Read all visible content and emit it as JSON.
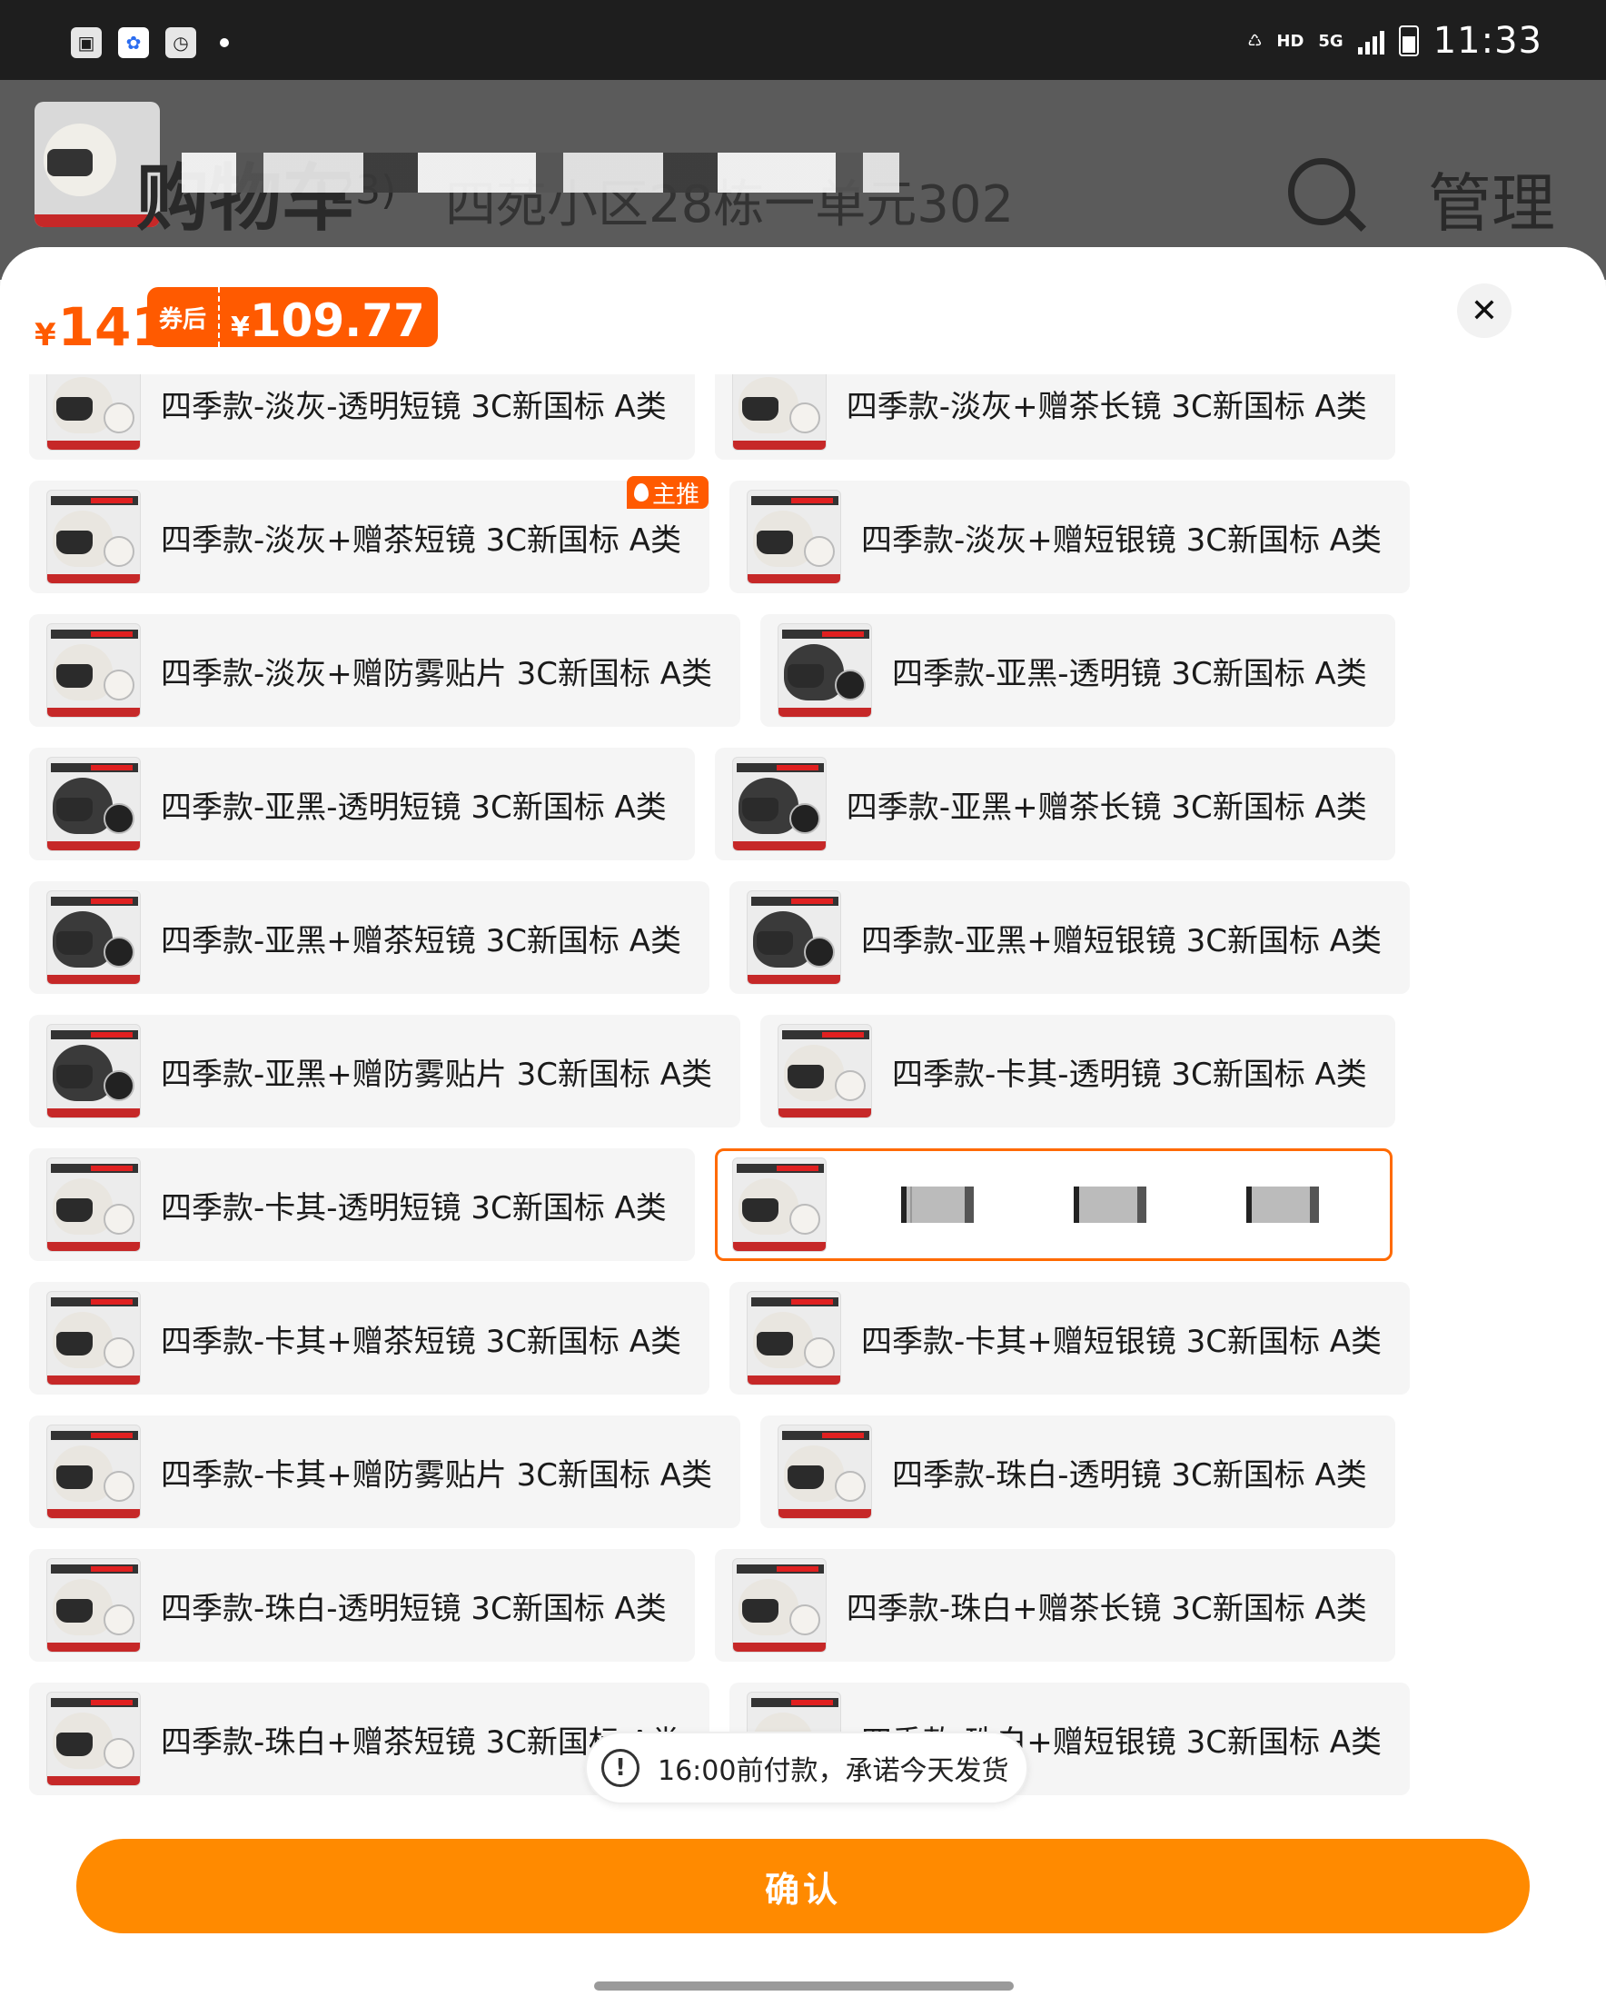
{
  "status_bar": {
    "time": "11:33",
    "hd": "HD",
    "net": "5G",
    "icons": [
      "image-icon",
      "baidu-icon",
      "clock-app-icon",
      "dot-icon",
      "battery-saver-icon",
      "signal-icon",
      "battery-icon"
    ]
  },
  "background": {
    "title": "购物车",
    "count": "(23)",
    "address": "四苑小区28栋一单元302",
    "manage": "管理"
  },
  "sheet": {
    "price_currency": "¥",
    "price": "141",
    "coupon_tag": "券后",
    "coupon_currency": "¥",
    "coupon_price": "109.77",
    "close": "✕"
  },
  "options": [
    [
      {
        "label": "四季款-淡灰-透明短镜 3C新国标 A类",
        "color": "light"
      },
      {
        "label": "四季款-淡灰+赠茶长镜 3C新国标 A类",
        "color": "light"
      }
    ],
    [
      {
        "label": "四季款-淡灰+赠茶短镜 3C新国标 A类",
        "color": "light",
        "badge": "主推"
      },
      {
        "label": "四季款-淡灰+赠短银镜 3C新国标 A类",
        "color": "light"
      }
    ],
    [
      {
        "label": "四季款-淡灰+赠防雾贴片 3C新国标 A类",
        "color": "light"
      },
      {
        "label": "四季款-亚黑-透明镜 3C新国标 A类",
        "color": "dark"
      }
    ],
    [
      {
        "label": "四季款-亚黑-透明短镜 3C新国标 A类",
        "color": "dark"
      },
      {
        "label": "四季款-亚黑+赠茶长镜 3C新国标 A类",
        "color": "dark"
      }
    ],
    [
      {
        "label": "四季款-亚黑+赠茶短镜 3C新国标 A类",
        "color": "dark"
      },
      {
        "label": "四季款-亚黑+赠短银镜 3C新国标 A类",
        "color": "dark"
      }
    ],
    [
      {
        "label": "四季款-亚黑+赠防雾贴片 3C新国标 A类",
        "color": "dark"
      },
      {
        "label": "四季款-卡其-透明镜 3C新国标 A类",
        "color": "light"
      }
    ],
    [
      {
        "label": "四季款-卡其-透明短镜 3C新国标 A类",
        "color": "light"
      },
      {
        "label": "",
        "color": "light",
        "selected": true,
        "redacted": true
      }
    ],
    [
      {
        "label": "四季款-卡其+赠茶短镜 3C新国标 A类",
        "color": "light"
      },
      {
        "label": "四季款-卡其+赠短银镜 3C新国标 A类",
        "color": "light"
      }
    ],
    [
      {
        "label": "四季款-卡其+赠防雾贴片 3C新国标 A类",
        "color": "light"
      },
      {
        "label": "四季款-珠白-透明镜 3C新国标 A类",
        "color": "light"
      }
    ],
    [
      {
        "label": "四季款-珠白-透明短镜 3C新国标 A类",
        "color": "light"
      },
      {
        "label": "四季款-珠白+赠茶长镜 3C新国标 A类",
        "color": "light"
      }
    ],
    [
      {
        "label": "四季款-珠白+赠茶短镜 3C新国标 A类",
        "color": "light"
      },
      {
        "label": "四季款-珠白+赠短银镜 3C新国标 A类",
        "color": "light"
      }
    ]
  ],
  "notice": {
    "icon": "!",
    "text": "16:00前付款，承诺今天发货"
  },
  "confirm_label": "确认",
  "colors": {
    "accent": "#ff5a00",
    "confirm": "#ff8a00",
    "helmet_light": "#e9e6e0",
    "helmet_dark": "#3a3a3a"
  }
}
